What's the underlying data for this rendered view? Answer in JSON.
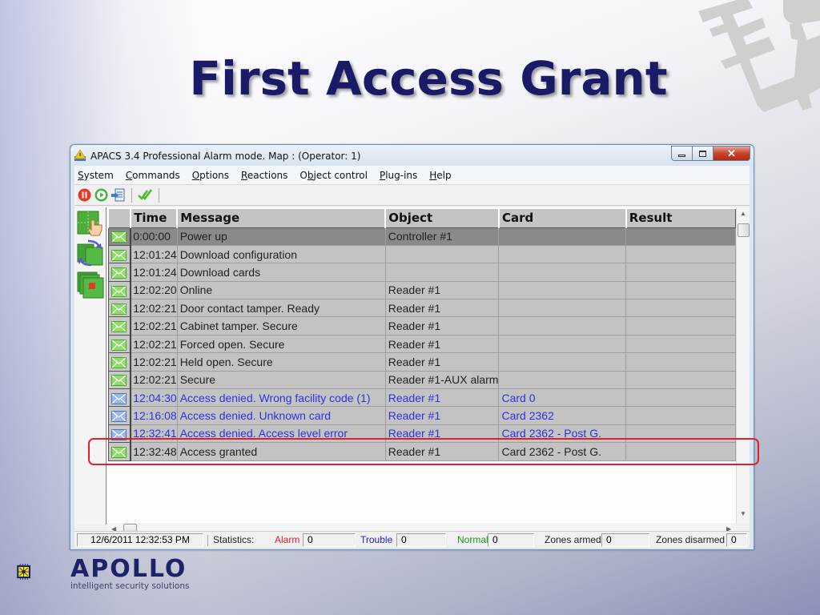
{
  "slide": {
    "title": "First Access Grant",
    "logo_name": "APOLLO",
    "logo_tagline": "intelligent security solutions"
  },
  "window": {
    "title": "APACS 3.4 Professional Alarm mode.  Map :  (Operator: 1)",
    "controls": {
      "minimize": "minimize",
      "maximize": "maximize",
      "close": "close"
    }
  },
  "menu": [
    {
      "key": "S",
      "rest": "ystem"
    },
    {
      "key": "C",
      "rest": "ommands"
    },
    {
      "key": "O",
      "rest": "ptions"
    },
    {
      "key": "R",
      "rest": "eactions"
    },
    {
      "pre": "O",
      "key": "b",
      "rest": "ject control"
    },
    {
      "key": "P",
      "rest": "lug-ins"
    },
    {
      "key": "H",
      "rest": "elp"
    }
  ],
  "toolbar": {
    "buttons": [
      "stop-icon",
      "play-icon",
      "export-icon",
      "check-icon"
    ]
  },
  "left_panel": {
    "buttons": [
      "hand-pointer-map-icon",
      "switch-maps-icon",
      "alarm-layers-icon"
    ]
  },
  "table": {
    "columns": [
      "Time",
      "Message",
      "Object",
      "Card",
      "Result"
    ],
    "rows": [
      {
        "time": " 0:00:00",
        "message": "Power up",
        "object": "Controller #1",
        "card": "",
        "result": "",
        "type": "normal",
        "selected": true
      },
      {
        "time": "12:01:24",
        "message": "Download configuration",
        "object": "",
        "card": "",
        "result": "",
        "type": "normal"
      },
      {
        "time": "12:01:24",
        "message": "Download cards",
        "object": "",
        "card": "",
        "result": "",
        "type": "normal"
      },
      {
        "time": "12:02:20",
        "message": "Online",
        "object": "Reader #1",
        "card": "",
        "result": "",
        "type": "normal"
      },
      {
        "time": "12:02:21",
        "message": "Door contact tamper. Ready",
        "object": "Reader #1",
        "card": "",
        "result": "",
        "type": "normal"
      },
      {
        "time": "12:02:21",
        "message": "Cabinet tamper. Secure",
        "object": "Reader #1",
        "card": "",
        "result": "",
        "type": "normal"
      },
      {
        "time": "12:02:21",
        "message": "Forced open. Secure",
        "object": "Reader #1",
        "card": "",
        "result": "",
        "type": "normal"
      },
      {
        "time": "12:02:21",
        "message": "Held open. Secure",
        "object": "Reader #1",
        "card": "",
        "result": "",
        "type": "normal"
      },
      {
        "time": "12:02:21",
        "message": "Secure",
        "object": "Reader #1-AUX alarm",
        "card": "",
        "result": "",
        "type": "normal"
      },
      {
        "time": "12:04:30",
        "message": "Access denied. Wrong facility code (1)",
        "object": "Reader #1",
        "card": "Card  0",
        "result": "",
        "type": "trouble"
      },
      {
        "time": "12:16:08",
        "message": "Access denied. Unknown card",
        "object": "Reader #1",
        "card": "Card  2362",
        "result": "",
        "type": "trouble"
      },
      {
        "time": "12:32:41",
        "message": "Access denied. Access level error",
        "object": "Reader #1",
        "card": "Card  2362 - Post G.",
        "result": "",
        "type": "trouble"
      },
      {
        "time": "12:32:48",
        "message": "Access granted",
        "object": "Reader #1",
        "card": "Card  2362 - Post G.",
        "result": "",
        "type": "normal",
        "highlighted": true
      }
    ]
  },
  "statusbar": {
    "datetime": "12/6/2011 12:32:53 PM",
    "statistics_label": "Statistics:",
    "alarm_label": "Alarm",
    "alarm_value": "0",
    "trouble_label": "Trouble",
    "trouble_value": "0",
    "normal_label": "Normal",
    "normal_value": "0",
    "zones_armed_label": "Zones armed",
    "zones_armed_value": "0",
    "zones_disarmed_label": "Zones disarmed",
    "zones_disarmed_value": "0"
  },
  "colors": {
    "title": "#1a1a66",
    "alarm": "#e0202a",
    "trouble": "#3030dd",
    "normal": "#1a9a1a",
    "highlight": "#e0202a"
  }
}
